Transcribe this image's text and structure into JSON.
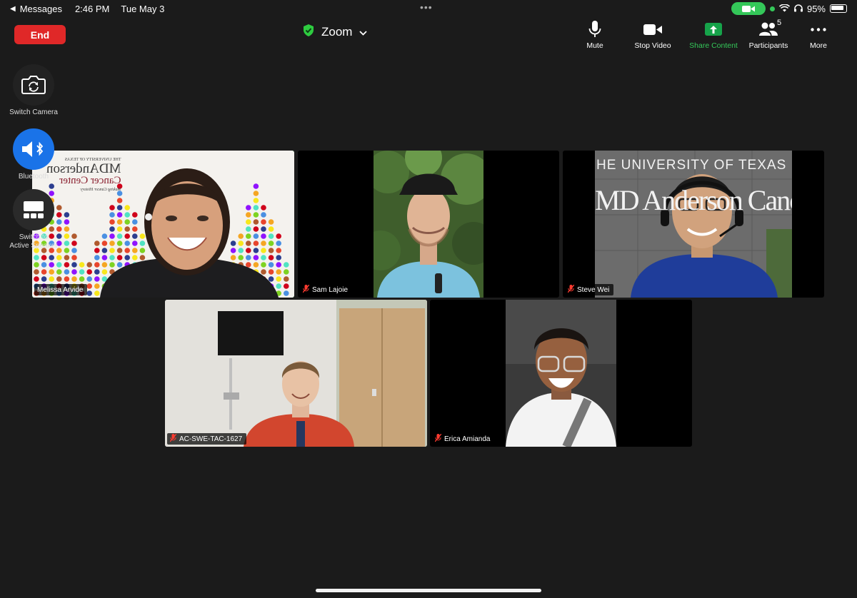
{
  "status_bar": {
    "back_app": "Messages",
    "time": "2:46 PM",
    "date": "Tue May 3",
    "battery": "95%"
  },
  "top_bar": {
    "end_label": "End",
    "meeting_title": "Zoom",
    "toolbar": {
      "mute": "Mute",
      "stop_video": "Stop Video",
      "share_content": "Share Content",
      "participants": "Participants",
      "participants_count": "5",
      "more": "More"
    }
  },
  "side_controls": {
    "switch_camera": "Switch Camera",
    "bluetooth": "Bluetooth",
    "active_speaker_line1": "Switch to",
    "active_speaker_line2": "Active Speaker"
  },
  "participants": [
    {
      "name": "Melissa Arvide",
      "muted": false,
      "active": true
    },
    {
      "name": "Sam Lajoie",
      "muted": true
    },
    {
      "name": "Steve Wei",
      "muted": true
    },
    {
      "name": "AC-SWE-TAC-1627",
      "muted": true
    },
    {
      "name": "Erica Amianda",
      "muted": true
    }
  ],
  "backgrounds": {
    "melissa_logo_line1": "THE UNIVERSITY OF TEXAS",
    "melissa_logo_line2": "MDAnderson",
    "melissa_logo_line3": "Cancer Center",
    "melissa_logo_line4": "Making Cancer History",
    "steve_wall_line1": "HE UNIVERSITY OF TEXAS",
    "steve_wall_line2": "MD Anderson Cancer C"
  },
  "colors": {
    "end": "#e02828",
    "active_speaker": "#32d74b",
    "share": "#34c759",
    "bluetooth": "#1a73e8",
    "muted": "#ff3b30"
  }
}
